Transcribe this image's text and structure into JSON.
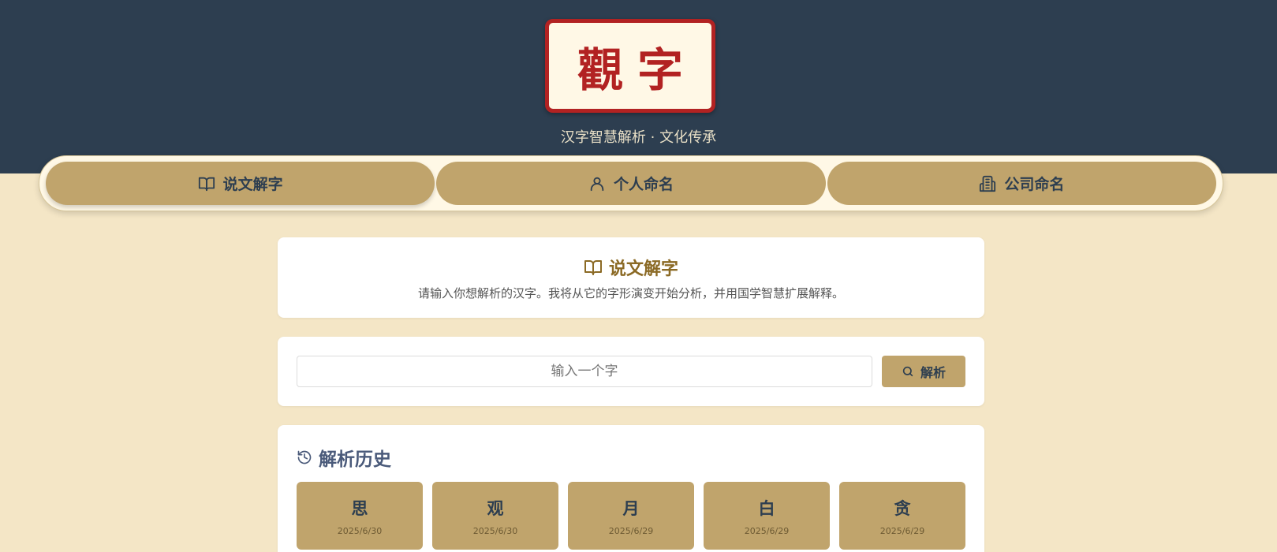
{
  "header": {
    "logo_text": "觀字",
    "subtitle": "汉字智慧解析 · 文化传承"
  },
  "tabs": [
    {
      "label": "说文解字",
      "icon": "book-open-icon",
      "active": true
    },
    {
      "label": "个人命名",
      "icon": "user-icon",
      "active": false
    },
    {
      "label": "公司命名",
      "icon": "building-icon",
      "active": false
    }
  ],
  "intro": {
    "title": "说文解字",
    "description": "请输入你想解析的汉字。我将从它的字形演变开始分析，并用国学智慧扩展解释。"
  },
  "search": {
    "placeholder": "输入一个字",
    "value": "",
    "button_label": "解析"
  },
  "history": {
    "title": "解析历史",
    "items": [
      {
        "char": "思",
        "date": "2025/6/30"
      },
      {
        "char": "观",
        "date": "2025/6/30"
      },
      {
        "char": "月",
        "date": "2025/6/29"
      },
      {
        "char": "白",
        "date": "2025/6/29"
      },
      {
        "char": "贪",
        "date": "2025/6/29"
      }
    ]
  },
  "colors": {
    "header_bg": "#2d3e50",
    "page_bg": "#f4e6c6",
    "accent_gold": "#c0a46c",
    "logo_red": "#b22222"
  }
}
